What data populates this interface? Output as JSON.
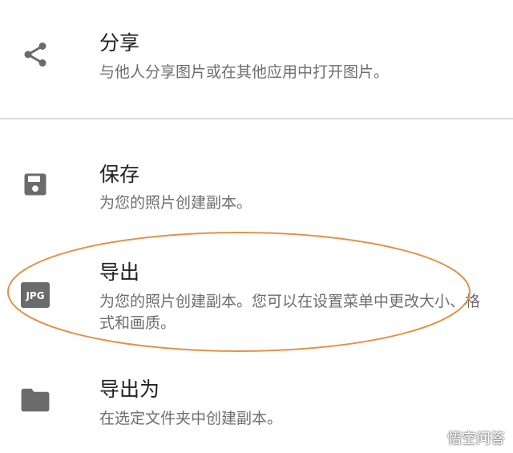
{
  "menu": {
    "items": [
      {
        "icon": "share-icon",
        "title": "分享",
        "description": "与他人分享图片或在其他应用中打开图片。"
      },
      {
        "icon": "save-icon",
        "title": "保存",
        "description": "为您的照片创建副本。"
      },
      {
        "icon": "jpg-file-icon",
        "icon_text": "JPG",
        "title": "导出",
        "description": "为您的照片创建副本。您可以在设置菜单中更改大小、格式和画质。"
      },
      {
        "icon": "folder-icon",
        "title": "导出为",
        "description": "在选定文件夹中创建副本。"
      }
    ]
  },
  "annotation": {
    "color": "#e0934a"
  },
  "watermark": {
    "text": "悟空问答"
  }
}
